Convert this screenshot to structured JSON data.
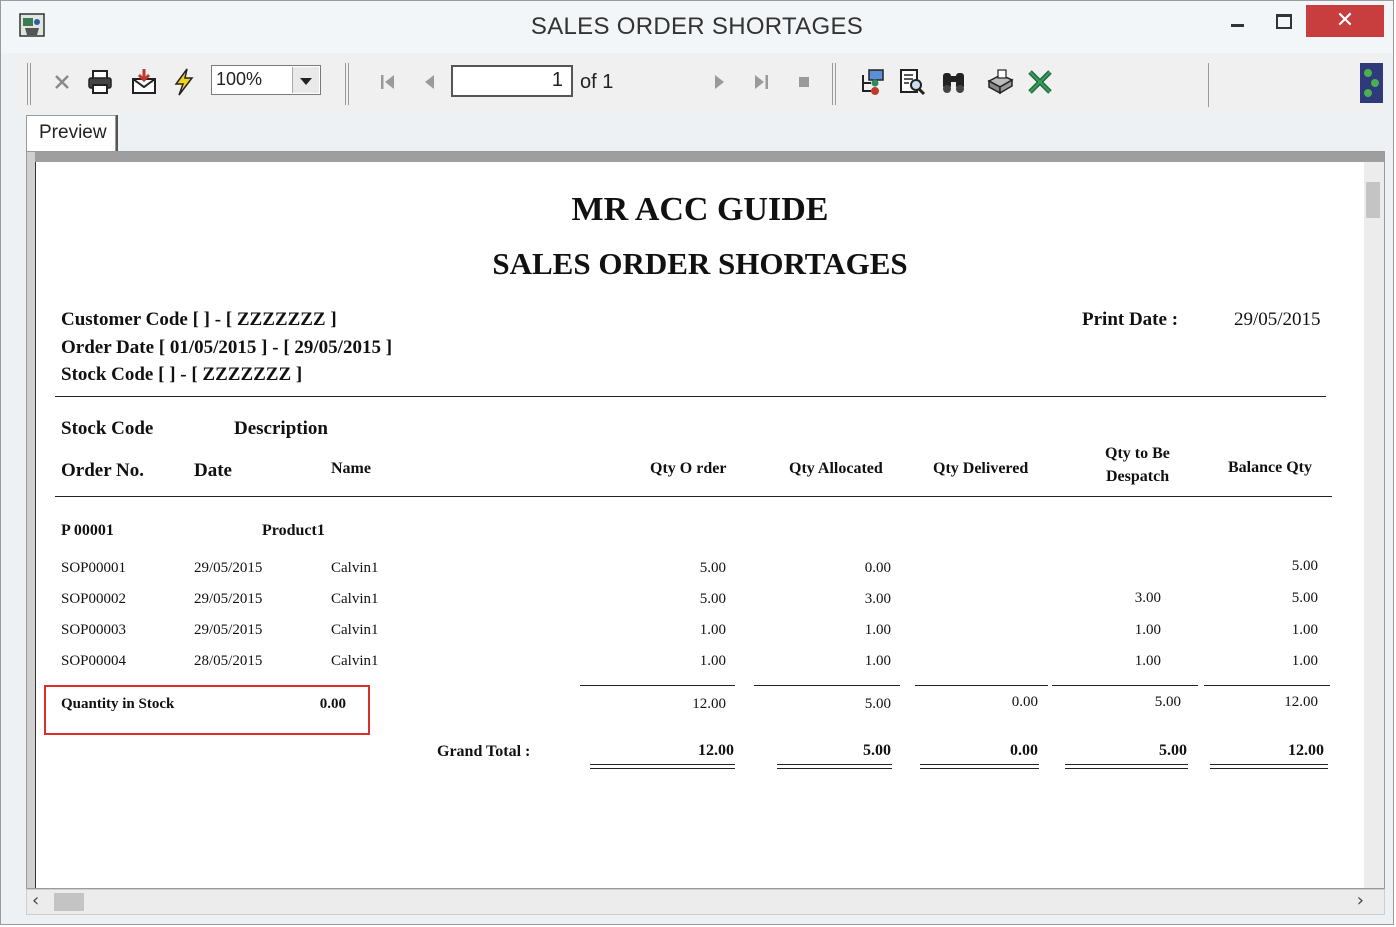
{
  "window": {
    "title": "SALES ORDER SHORTAGES"
  },
  "toolbar": {
    "zoom": "100%",
    "page_current": "1",
    "page_of": "of 1",
    "icons": [
      "close-icon",
      "print-icon",
      "export-icon",
      "refresh-icon",
      "first-page-icon",
      "prev-page-icon",
      "next-page-icon",
      "last-page-icon",
      "stop-icon",
      "group-tree-icon",
      "search-text-icon",
      "find-icon",
      "print-setup-icon",
      "excel-icon"
    ]
  },
  "tab": {
    "label": "Preview"
  },
  "report": {
    "company": "MR ACC GUIDE",
    "title": "SALES ORDER SHORTAGES",
    "filters": {
      "customer": "Customer Code  [  ] - [ ZZZZZZZ ]",
      "order_date": "Order Date [ 01/05/2015 ]  -  [ 29/05/2015 ]",
      "stock": "Stock Code  [  ]  - [ ZZZZZZZ ]"
    },
    "print_date_label": "Print Date :",
    "print_date": "29/05/2015",
    "headers": {
      "stock_code": "Stock Code",
      "description": "Description",
      "order_no": "Order  No.",
      "date": "Date",
      "name": "Name",
      "qty_order": "Qty O rder",
      "qty_allocated": "Qty Allocated",
      "qty_delivered": "Qty Delivered",
      "qty_to_be_line1": "Qty to Be",
      "qty_to_be_line2": "Despatch",
      "balance_qty": "Balance Qty"
    },
    "group": {
      "stock_code": "P 00001",
      "description": "Product1"
    },
    "rows": [
      {
        "order_no": "SOP00001",
        "date": "29/05/2015",
        "name": "Calvin1",
        "qty_order": "5.00",
        "qty_allocated": "0.00",
        "qty_delivered": "",
        "qty_despatch": "",
        "balance": "5.00"
      },
      {
        "order_no": "SOP00002",
        "date": "29/05/2015",
        "name": "Calvin1",
        "qty_order": "5.00",
        "qty_allocated": "3.00",
        "qty_delivered": "",
        "qty_despatch": "3.00",
        "balance": "5.00"
      },
      {
        "order_no": "SOP00003",
        "date": "29/05/2015",
        "name": "Calvin1",
        "qty_order": "1.00",
        "qty_allocated": "1.00",
        "qty_delivered": "",
        "qty_despatch": "1.00",
        "balance": "1.00"
      },
      {
        "order_no": "SOP00004",
        "date": "28/05/2015",
        "name": "Calvin1",
        "qty_order": "1.00",
        "qty_allocated": "1.00",
        "qty_delivered": "",
        "qty_despatch": "1.00",
        "balance": "1.00"
      }
    ],
    "subtotal": {
      "stock_label": "Quantity in Stock",
      "stock_value": "0.00",
      "qty_order": "12.00",
      "qty_allocated": "5.00",
      "qty_delivered": "0.00",
      "qty_despatch": "5.00",
      "balance": "12.00"
    },
    "grand_total": {
      "label": "Grand Total :",
      "qty_order": "12.00",
      "qty_allocated": "5.00",
      "qty_delivered": "0.00",
      "qty_despatch": "5.00",
      "balance": "12.00"
    }
  },
  "colors": {
    "close_button": "#c83d3d",
    "highlight_box": "#d9302c"
  }
}
